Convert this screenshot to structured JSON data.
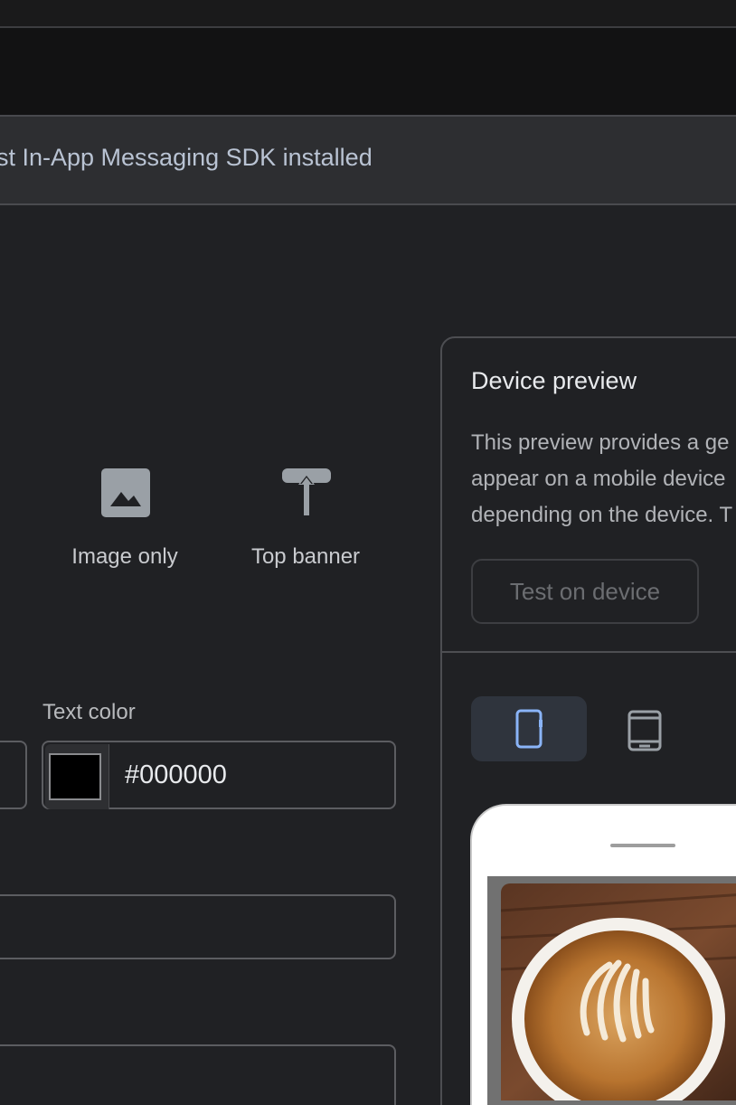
{
  "banner": {
    "text": "st In-App Messaging SDK installed"
  },
  "layouts": {
    "image_only": {
      "label": "Image only",
      "icon": "image-icon"
    },
    "top_banner": {
      "label": "Top banner",
      "icon": "top-banner-icon"
    }
  },
  "style": {
    "text_color_label": "Text color",
    "text_color_value": "#000000"
  },
  "preview": {
    "title": "Device preview",
    "description_lines": [
      "This preview provides a ge",
      "appear on a mobile device",
      "depending on the device. T"
    ],
    "test_button_label": "Test on device",
    "devices": {
      "phone": {
        "icon": "smartphone-icon",
        "selected": true
      },
      "tablet": {
        "icon": "tablet-icon",
        "selected": false
      }
    }
  },
  "colors": {
    "accent": "#8ab4f8",
    "background": "#202124",
    "banner_bg": "#2d2e31"
  }
}
